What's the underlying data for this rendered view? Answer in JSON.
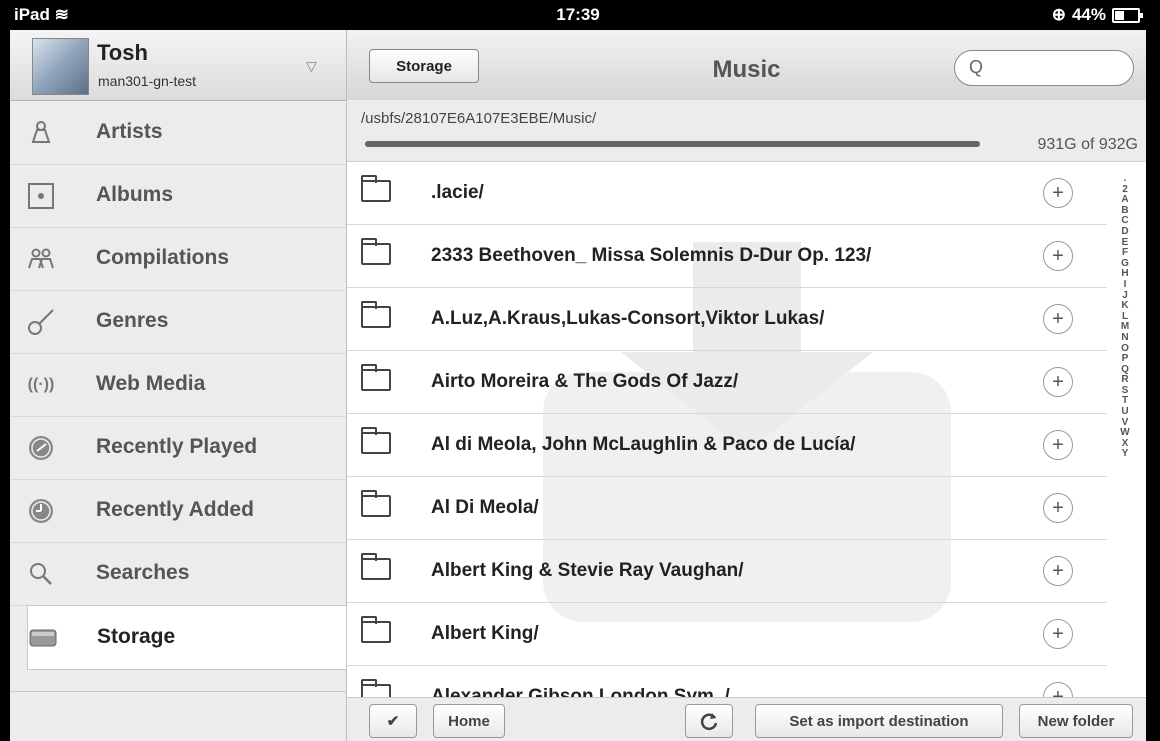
{
  "status_bar": {
    "device": "iPad",
    "time": "17:39",
    "battery": "44%"
  },
  "user": {
    "name": "Tosh",
    "server": "man301-gn-test"
  },
  "sidebar": {
    "items": [
      {
        "label": "Artists",
        "icon": "artist-icon"
      },
      {
        "label": "Albums",
        "icon": "album-icon"
      },
      {
        "label": "Compilations",
        "icon": "compilations-icon"
      },
      {
        "label": "Genres",
        "icon": "guitar-icon"
      },
      {
        "label": "Web Media",
        "icon": "antenna-icon"
      },
      {
        "label": "Recently Played",
        "icon": "clock-icon"
      },
      {
        "label": "Recently Added",
        "icon": "clock-icon"
      },
      {
        "label": "Searches",
        "icon": "search-icon"
      },
      {
        "label": "Storage",
        "icon": "storage-icon",
        "selected": true
      }
    ]
  },
  "navbar": {
    "back_label": "Storage",
    "title": "Music",
    "search_placeholder": ""
  },
  "path": {
    "value": "/usbfs/28107E6A107E3EBE/Music/",
    "capacity": "931G of 932G",
    "used_fraction": 0.999
  },
  "folders": [
    ".lacie/",
    "2333 Beethoven_ Missa Solemnis D-Dur Op. 123/",
    "A.Luz,A.Kraus,Lukas-Consort,Viktor Lukas/",
    "Airto Moreira & The Gods Of Jazz/",
    "Al di Meola, John McLaughlin & Paco de Lucía/",
    "Al Di Meola/",
    "Albert King & Stevie Ray Vaughan/",
    "Albert King/",
    "Alexander Gibson London Sym. /"
  ],
  "alpha_index": [
    ".",
    "2",
    "A",
    "B",
    "C",
    "D",
    "E",
    "F",
    "G",
    "H",
    "I",
    "J",
    "K",
    "L",
    "M",
    "N",
    "O",
    "P",
    "Q",
    "R",
    "S",
    "T",
    "U",
    "V",
    "W",
    "X",
    "Y"
  ],
  "toolbar": {
    "check": "✔",
    "home": "Home",
    "set_import": "Set as import destination",
    "new_folder": "New folder"
  }
}
